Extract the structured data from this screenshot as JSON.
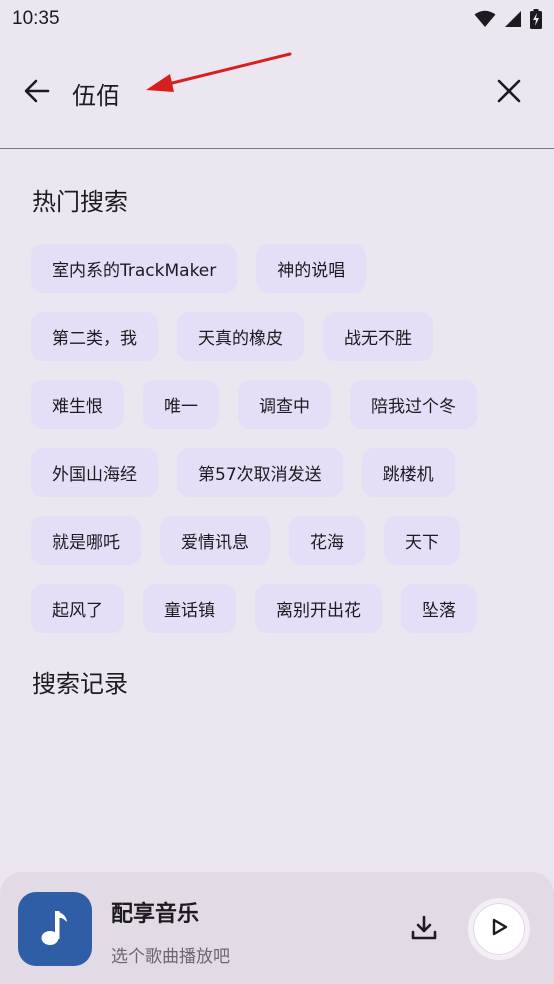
{
  "status_bar": {
    "time": "10:35"
  },
  "search": {
    "value": "伍佰"
  },
  "hot": {
    "title": "热门搜索",
    "rows": [
      [
        "室内系的TrackMaker",
        "神的说唱"
      ],
      [
        "第二类，我",
        "天真的橡皮",
        "战无不胜"
      ],
      [
        "难生恨",
        "唯一",
        "调查中",
        "陪我过个冬"
      ],
      [
        "外国山海经",
        "第57次取消发送",
        "跳楼机"
      ],
      [
        "就是哪吒",
        "爱情讯息",
        "花海",
        "天下"
      ],
      [
        "起风了",
        "童话镇",
        "离别开出花",
        "坠落"
      ]
    ]
  },
  "history": {
    "title": "搜索记录"
  },
  "player": {
    "title": "配享音乐",
    "subtitle": "选个歌曲播放吧"
  },
  "colors": {
    "background": "#ece6f0",
    "chip": "#e6ddf6",
    "album_art": "#2f5ea6",
    "annotation_arrow": "#d81f1f"
  },
  "icons": {
    "back": "arrow-left-icon",
    "clear": "close-icon",
    "download": "download-icon",
    "play": "play-icon",
    "music": "music-note-icon",
    "wifi": "wifi-icon",
    "signal": "signal-icon",
    "battery": "battery-charging-icon"
  }
}
